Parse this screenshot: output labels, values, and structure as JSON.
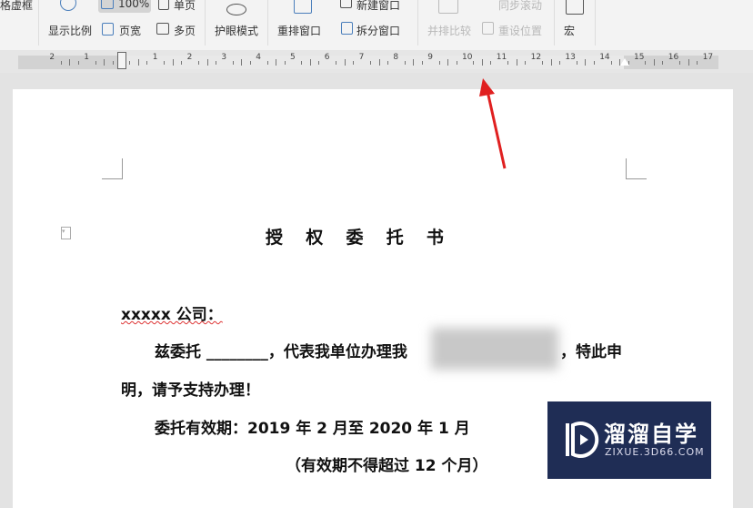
{
  "toolbar": {
    "cut_label": "格虚框",
    "zoom_label": "显示比例",
    "zoom100_label": "100%",
    "single_page": "单页",
    "page_width": "页宽",
    "multi_page": "多页",
    "eye_mode": "护眼模式",
    "arrange_window": "重排窗口",
    "new_window": "新建窗口",
    "split_window": "拆分窗口",
    "side_by_side": "并排比较",
    "sync_scroll": "同步滚动",
    "reset_position": "重设位置",
    "macro": "宏"
  },
  "ruler": {
    "labels": [
      "2",
      "1",
      "",
      "1",
      "2",
      "3",
      "4",
      "5",
      "6",
      "7",
      "8",
      "9",
      "10",
      "11",
      "12",
      "13",
      "14",
      "15",
      "16",
      "17"
    ]
  },
  "document": {
    "title": "授  权  委  托  书",
    "line1": "xxxxx 公司：",
    "line2a": "兹委托 ________，代表我单位办理我",
    "line2b": "，特此申",
    "line3": "明，请予支持办理！",
    "line4": "委托有效期：2019 年 2 月至 2020 年 1 月",
    "line5": "（有效期不得超过 12 个月）"
  },
  "watermark": {
    "name": "溜溜自学",
    "url": "ZIXUE.3D66.COM"
  },
  "colors": {
    "arrow": "#e02020",
    "watermark_bg": "#1f2d55"
  }
}
